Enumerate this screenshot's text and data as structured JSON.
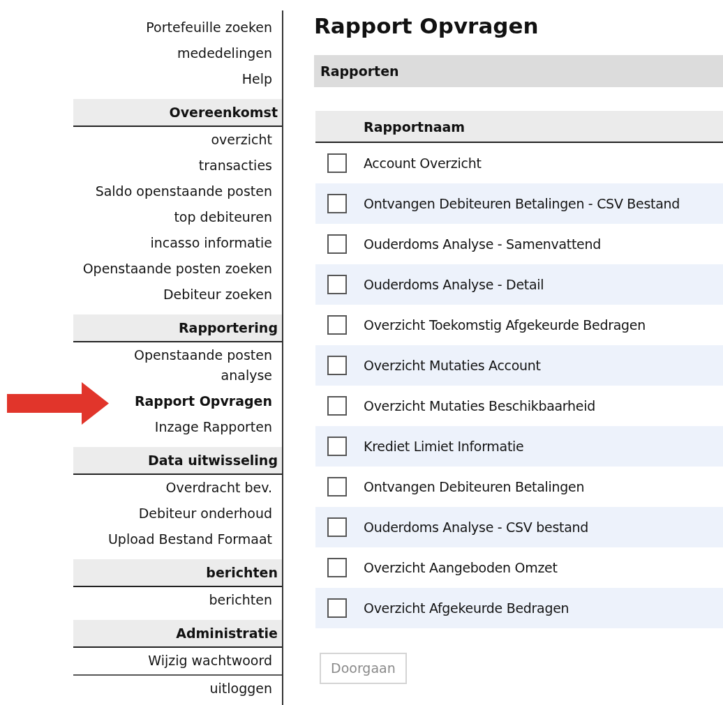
{
  "sidebar": {
    "links": [
      {
        "label": "Portefeuille zoeken",
        "selected": false
      },
      {
        "label": "mededelingen",
        "selected": false
      },
      {
        "label": "Help",
        "selected": false
      }
    ],
    "sections": [
      {
        "title": "Overeenkomst",
        "items": [
          {
            "label": "overzicht",
            "selected": false
          },
          {
            "label": "transacties",
            "selected": false
          },
          {
            "label": "Saldo openstaande posten",
            "selected": false
          },
          {
            "label": "top debiteuren",
            "selected": false
          },
          {
            "label": "incasso informatie",
            "selected": false
          },
          {
            "label": "Openstaande posten zoeken",
            "selected": false
          },
          {
            "label": "Debiteur zoeken",
            "selected": false
          }
        ]
      },
      {
        "title": "Rapportering",
        "items": [
          {
            "label": "Openstaande posten\nanalyse",
            "selected": false
          },
          {
            "label": "Rapport Opvragen",
            "selected": true
          },
          {
            "label": "Inzage Rapporten",
            "selected": false
          }
        ]
      },
      {
        "title": "Data uitwisseling",
        "items": [
          {
            "label": "Overdracht bev.",
            "selected": false
          },
          {
            "label": "Debiteur onderhoud",
            "selected": false
          },
          {
            "label": "Upload Bestand Formaat",
            "selected": false
          }
        ]
      },
      {
        "title": "berichten",
        "items": [
          {
            "label": "berichten",
            "selected": false
          }
        ]
      },
      {
        "title": "Administratie",
        "items": [
          {
            "label": "Wijzig wachtwoord",
            "selected": false
          }
        ]
      }
    ],
    "logout": "uitloggen"
  },
  "page_title": "Rapport Opvragen",
  "panel_title": "Rapporten",
  "table": {
    "columns": [
      "Rapportnaam"
    ],
    "rows": [
      {
        "name": "Account Overzicht",
        "checked": false
      },
      {
        "name": "Ontvangen Debiteuren Betalingen - CSV Bestand",
        "checked": false
      },
      {
        "name": "Ouderdoms Analyse - Samenvattend",
        "checked": false
      },
      {
        "name": "Ouderdoms Analyse - Detail",
        "checked": false
      },
      {
        "name": "Overzicht Toekomstig Afgekeurde Bedragen",
        "checked": false
      },
      {
        "name": "Overzicht Mutaties Account",
        "checked": false
      },
      {
        "name": "Overzicht Mutaties Beschikbaarheid",
        "checked": false
      },
      {
        "name": "Krediet Limiet Informatie",
        "checked": false
      },
      {
        "name": "Ontvangen Debiteuren Betalingen",
        "checked": false
      },
      {
        "name": "Ouderdoms Analyse - CSV bestand",
        "checked": false
      },
      {
        "name": "Overzicht Aangeboden Omzet",
        "checked": false
      },
      {
        "name": "Overzicht Afgekeurde Bedragen",
        "checked": false
      }
    ]
  },
  "button": {
    "label": "Doorgaan",
    "disabled": true
  }
}
